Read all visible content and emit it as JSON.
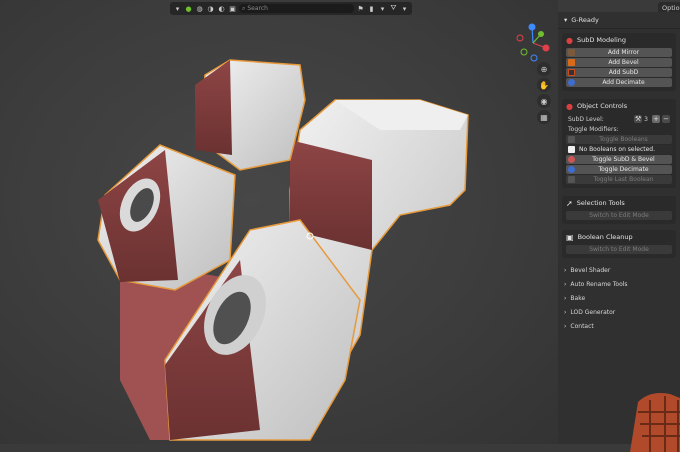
{
  "header": {
    "search_placeholder": "Search",
    "options_label": "Optio"
  },
  "navigation": {
    "tools": [
      "zoom",
      "pan",
      "camera",
      "grid"
    ]
  },
  "sidebar": {
    "title": "G-Ready",
    "subd_modeling": {
      "title": "SubD Modeling",
      "buttons": [
        "Add Mirror",
        "Add Bevel",
        "Add SubD",
        "Add Decimate"
      ]
    },
    "object_controls": {
      "title": "Object Controls",
      "subd_level_label": "SubD Level:",
      "subd_level_value": "3",
      "toggle_modifiers_label": "Toggle Modifiers:",
      "toggle_booleans": "Toggle Booleans",
      "no_booleans_msg": "No Booleans on selected.",
      "toggle_subd_bevel": "Toggle SubD & Bevel",
      "toggle_decimate": "Toggle Decimate",
      "toggle_last_boolean": "Toggle Last Boolean"
    },
    "selection_tools": {
      "title": "Selection Tools",
      "button": "Switch to Edit Mode"
    },
    "boolean_cleanup": {
      "title": "Boolean Cleanup",
      "button": "Switch to Edit Mode"
    },
    "collapsed_sections": [
      "Bevel Shader",
      "Auto Rename Tools",
      "Bake",
      "LOD Generator",
      "Contact"
    ]
  },
  "colors": {
    "accent_red": "#c0392b",
    "selection_outline": "#e69a3c",
    "axis_x": "#e0404a",
    "axis_y": "#6fbf2f",
    "axis_z": "#3d8bff"
  }
}
